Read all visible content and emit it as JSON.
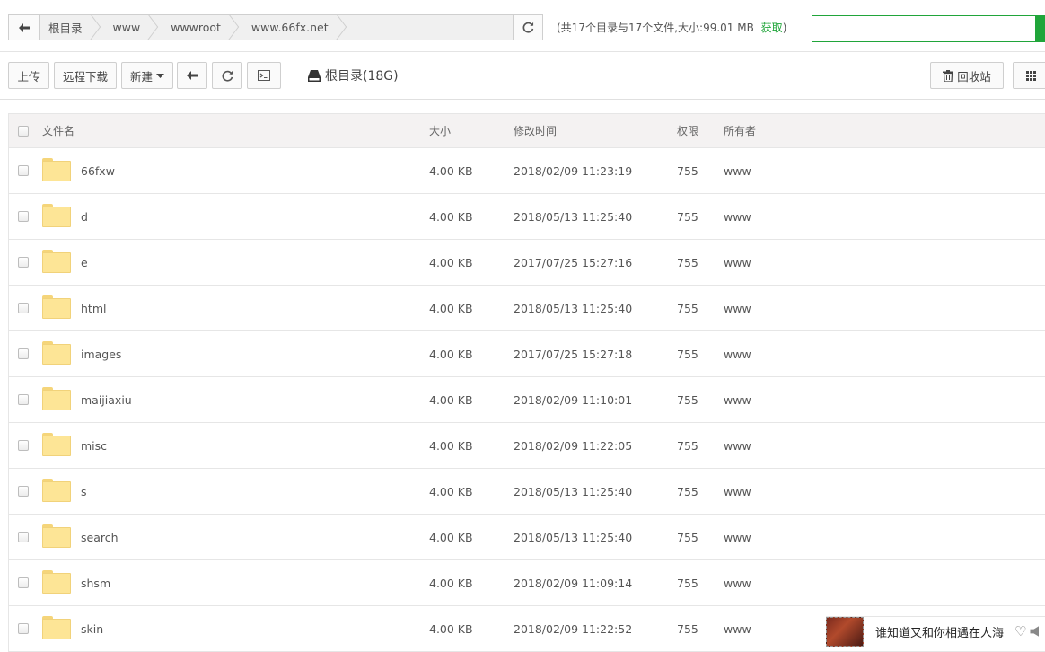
{
  "path": {
    "crumbs": [
      "根目录",
      "www",
      "wwwroot",
      "www.66fx.net"
    ],
    "summary": "(共17个目录与17个文件,大小:99.01 MB",
    "fetch_label": "获取",
    "summary_close": ")",
    "search_value": ""
  },
  "toolbar": {
    "upload": "上传",
    "remote_download": "远程下载",
    "new": "新建",
    "disk_label": "根目录(18G)",
    "recycle": "回收站"
  },
  "table": {
    "headers": {
      "name": "文件名",
      "size": "大小",
      "mtime": "修改时间",
      "perm": "权限",
      "owner": "所有者"
    },
    "rows": [
      {
        "name": "66fxw",
        "size": "4.00 KB",
        "mtime": "2018/02/09 11:23:19",
        "perm": "755",
        "owner": "www"
      },
      {
        "name": "d",
        "size": "4.00 KB",
        "mtime": "2018/05/13 11:25:40",
        "perm": "755",
        "owner": "www"
      },
      {
        "name": "e",
        "size": "4.00 KB",
        "mtime": "2017/07/25 15:27:16",
        "perm": "755",
        "owner": "www"
      },
      {
        "name": "html",
        "size": "4.00 KB",
        "mtime": "2018/05/13 11:25:40",
        "perm": "755",
        "owner": "www"
      },
      {
        "name": "images",
        "size": "4.00 KB",
        "mtime": "2017/07/25 15:27:18",
        "perm": "755",
        "owner": "www"
      },
      {
        "name": "maijiaxiu",
        "size": "4.00 KB",
        "mtime": "2018/02/09 11:10:01",
        "perm": "755",
        "owner": "www"
      },
      {
        "name": "misc",
        "size": "4.00 KB",
        "mtime": "2018/02/09 11:22:05",
        "perm": "755",
        "owner": "www"
      },
      {
        "name": "s",
        "size": "4.00 KB",
        "mtime": "2018/05/13 11:25:40",
        "perm": "755",
        "owner": "www"
      },
      {
        "name": "search",
        "size": "4.00 KB",
        "mtime": "2018/05/13 11:25:40",
        "perm": "755",
        "owner": "www"
      },
      {
        "name": "shsm",
        "size": "4.00 KB",
        "mtime": "2018/02/09 11:09:14",
        "perm": "755",
        "owner": "www"
      },
      {
        "name": "skin",
        "size": "4.00 KB",
        "mtime": "2018/02/09 11:22:52",
        "perm": "755",
        "owner": "www"
      }
    ]
  },
  "music": {
    "song": "谁知道又和你相遇在人海"
  },
  "colors": {
    "accent": "#20a53a",
    "folder": "#fde596",
    "header_bg": "#f4f2f2"
  }
}
